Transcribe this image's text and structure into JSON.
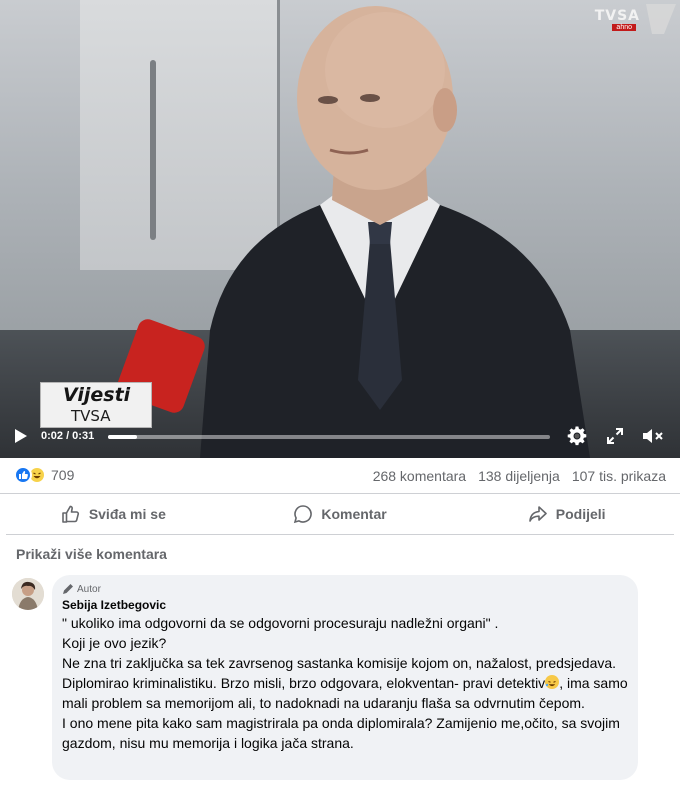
{
  "video": {
    "channel_logo": "TVSA",
    "channel_sub": "ahno",
    "lower_third_line1": "Vijesti",
    "lower_third_line2": "TVSA",
    "time": "0:02 / 0:31",
    "progress": 0.065,
    "icons": [
      "play-icon",
      "gear-icon",
      "expand-icon",
      "mute-icon"
    ]
  },
  "stats": {
    "reaction_count": "709",
    "comments": "268 komentara",
    "shares": "138 dijeljenja",
    "views": "107 tis. prikaza"
  },
  "actions": {
    "like": "Sviđa mi se",
    "comment": "Komentar",
    "share": "Podijeli"
  },
  "more_comments": "Prikaži više komentara",
  "comment": {
    "badge": "Autor",
    "author": "Sebija Izetbegovic",
    "text_1": "\" ukoliko ima odgovorni da se odgovorni procesuraju nadležni organi\" .\nKoji je ovo jezik?\nNe zna tri zaključka sa tek zavrsenog sastanka komisije kojom on, nažalost, predsjedava. Diplomirao kriminalistiku. Brzo misli, brzo odgovara, elokventan- pravi detektiv",
    "text_2": ", ima samo mali problem sa memorijom ali, to nadoknadi na udaranju flaša sa odvrnutim čepom.\nI ono mene pita kako sam magistrirala pa onda diplomirala? Zamijenio me,očito, sa svojim gazdom, nisu mu memorija i logika jača strana."
  },
  "colors": {
    "brand_blue": "#1877f2",
    "secondary_text": "#65676b",
    "bubble_bg": "#f0f2f5"
  }
}
